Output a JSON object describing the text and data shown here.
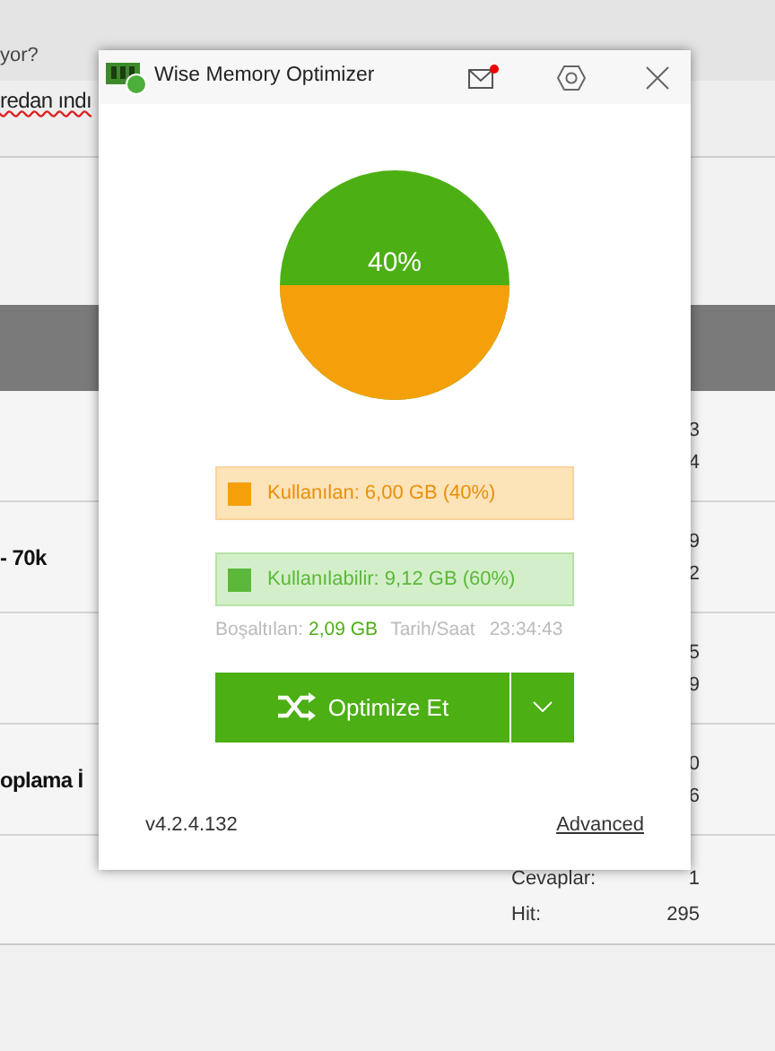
{
  "background_page": {
    "header_text": "yor?",
    "title_fragment": "redan ındı",
    "topics": [
      {
        "stats": [
          "3",
          "4"
        ]
      },
      {
        "title": "- 70k",
        "stats": [
          "9",
          "2"
        ]
      },
      {
        "stats": [
          "5",
          "9"
        ]
      },
      {
        "title": "oplama İ",
        "stats": [
          "0",
          "6"
        ]
      }
    ],
    "last_topic": {
      "stats": [
        {
          "label": "Cevaplar:",
          "value": "1"
        },
        {
          "label": "Hit:",
          "value": "295"
        }
      ]
    }
  },
  "window": {
    "title": "Wise Memory Optimizer",
    "mail_unread": true
  },
  "gauge": {
    "label": "40%"
  },
  "legend": [
    {
      "text": "Kullanılan: 6,00 GB (40%)",
      "color": "#f5a00a"
    },
    {
      "text": "Kullanılabilir: 9,12 GB (60%)",
      "color": "#5cb83a"
    }
  ],
  "stats": {
    "freed_label": "Boşaltılan:",
    "freed_value": "2,09 GB",
    "time_label": "Tarih/Saat",
    "time_value": "23:34:43"
  },
  "optimize_button": {
    "label": "Optimize Et"
  },
  "footer": {
    "version": "v4.2.4.132",
    "link": "Advanced"
  }
}
